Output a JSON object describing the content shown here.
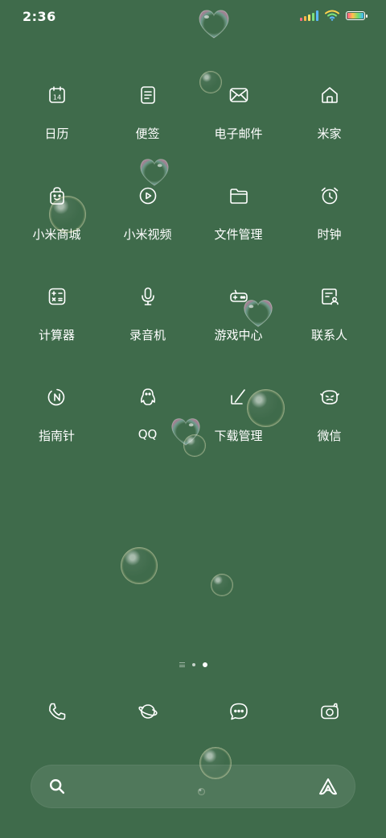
{
  "status_bar": {
    "time": "2:36",
    "icons": [
      "cellular-signal-icon",
      "wifi-icon",
      "battery-icon"
    ]
  },
  "apps": [
    {
      "label": "日历",
      "icon": "calendar-icon",
      "icon_text": "14"
    },
    {
      "label": "便签",
      "icon": "notes-icon"
    },
    {
      "label": "电子邮件",
      "icon": "email-icon"
    },
    {
      "label": "米家",
      "icon": "home-icon"
    },
    {
      "label": "小米商城",
      "icon": "shopping-bag-icon"
    },
    {
      "label": "小米视频",
      "icon": "video-play-icon"
    },
    {
      "label": "文件管理",
      "icon": "folder-icon"
    },
    {
      "label": "时钟",
      "icon": "alarm-clock-icon"
    },
    {
      "label": "计算器",
      "icon": "calculator-icon"
    },
    {
      "label": "录音机",
      "icon": "microphone-icon"
    },
    {
      "label": "游戏中心",
      "icon": "gamepad-icon"
    },
    {
      "label": "联系人",
      "icon": "contacts-icon"
    },
    {
      "label": "指南针",
      "icon": "compass-icon"
    },
    {
      "label": "QQ",
      "icon": "penguin-icon"
    },
    {
      "label": "下载管理",
      "icon": "download-arrow-icon"
    },
    {
      "label": "微信",
      "icon": "wechat-icon"
    }
  ],
  "page_indicator": {
    "total_pages": 2,
    "current_page": 2
  },
  "dock": [
    {
      "icon": "phone-icon"
    },
    {
      "icon": "browser-planet-icon"
    },
    {
      "icon": "message-icon"
    },
    {
      "icon": "camera-icon"
    }
  ],
  "search_bar": {
    "left_icon": "search-icon",
    "right_icon": "ai-assistant-icon"
  },
  "theme": {
    "background": "#3f6b4b",
    "foreground": "#ffffff"
  }
}
